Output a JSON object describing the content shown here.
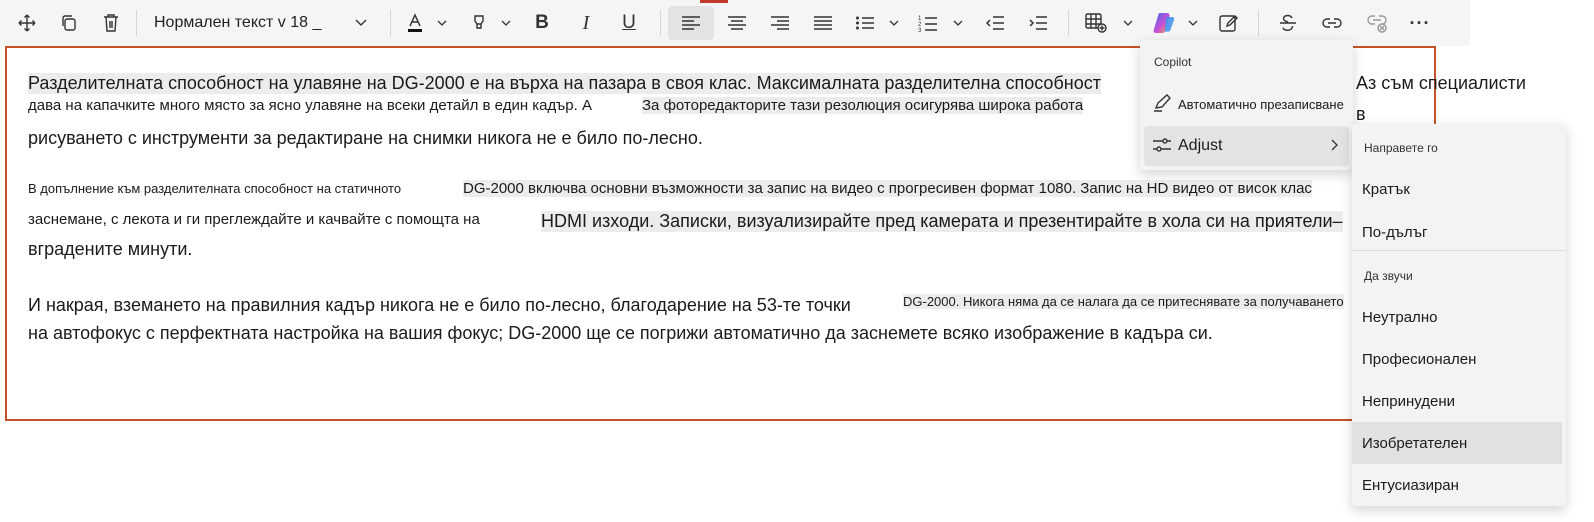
{
  "toolbar": {
    "style_value": "Нормален текст v 18 _",
    "buttons": [
      {
        "name": "move-icon"
      },
      {
        "name": "copy-icon"
      },
      {
        "name": "delete-icon"
      },
      {
        "name": "font-color-icon"
      },
      {
        "name": "highlight-icon"
      },
      {
        "name": "bold-icon"
      },
      {
        "name": "italic-icon"
      },
      {
        "name": "underline-icon"
      },
      {
        "name": "align-left-icon"
      },
      {
        "name": "align-center-icon"
      },
      {
        "name": "align-right-icon"
      },
      {
        "name": "justify-icon"
      },
      {
        "name": "bullet-list-icon"
      },
      {
        "name": "numbered-list-icon"
      },
      {
        "name": "decrease-indent-icon"
      },
      {
        "name": "increase-indent-icon"
      },
      {
        "name": "insert-table-icon"
      },
      {
        "name": "copilot-icon"
      },
      {
        "name": "rewrite-icon"
      },
      {
        "name": "strikethrough-icon"
      },
      {
        "name": "link-icon"
      },
      {
        "name": "unlink-icon"
      },
      {
        "name": "more-icon"
      }
    ],
    "bold_glyph": "B",
    "italic_glyph": "I",
    "underline_glyph": "U",
    "more_glyph": "···"
  },
  "document": {
    "lines": [
      {
        "text": "Разделителната способност на улавяне на DG-2000 е на върха на пазара в своя клас. Максималната разделителна способност",
        "size": "big",
        "hl": true
      },
      {
        "text": "дава на капачките много място за ясно улавяне на всеки детайл в един кадър. А",
        "size": "mid",
        "hl": false
      },
      {
        "text": "За фоторедакторите тази резолюция осигурява широка работа",
        "size": "mid",
        "hl": true
      },
      {
        "text": "рисуването с инструменти за редактиране на снимки никога не е било по-лесно.",
        "size": "big",
        "hl": false
      },
      {
        "text": "В допълнение към разделителната способност на статичното",
        "size": "small",
        "hl": false
      },
      {
        "text": "DG-2000 включва основни възможности за запис на видео с прогресивен формат 1080. Запис на HD видео от висок клас",
        "size": "mid",
        "hl": true
      },
      {
        "text": "заснемане, с лекота и ги преглеждайте и качвайте с помощта на",
        "size": "mid",
        "hl": false
      },
      {
        "text": "HDMI изходи. Записки, визуализирайте пред камерата и презентирайте в хола си на приятели–",
        "size": "big",
        "hl": true
      },
      {
        "text": "вградените минути.",
        "size": "big",
        "hl": false
      },
      {
        "text": "И накрая, вземането на правилния кадър никога не е било по-лесно, благодарение на 53-те точки",
        "size": "big",
        "hl": false
      },
      {
        "text": "DG-2000. Никога няма да се налага да се притеснявате за получаването",
        "size": "small",
        "hl": true
      },
      {
        "text": "на автофокус с перфектната настройка на вашия фокус; DG-2000 ще се погрижи автоматично да заснемете всяко изображение в кадъра си.",
        "size": "big",
        "hl": false
      }
    ],
    "side_text_1": "Аз съм специалисти",
    "side_text_2": "в"
  },
  "copilot_menu": {
    "header": "Copilot",
    "items": [
      {
        "label": "Автоматично презаписване",
        "icon": "rewrite-icon"
      },
      {
        "label": "Adjust",
        "icon": "adjust-icon"
      }
    ]
  },
  "adjust_menu": {
    "section1_header": "Направете го",
    "section1_items": [
      "Кратък",
      "По-дълъг"
    ],
    "section2_header": "Да звучи",
    "section2_items": [
      "Неутрално",
      "Професионален",
      "Непринудени",
      "Изобретателен",
      "Ентусиазиран"
    ],
    "selected": "Изобретателен"
  },
  "colors": {
    "frame_border": "#c5522a",
    "highlight": "#ececec",
    "copilot_gradient": [
      "#2f6fe4",
      "#c94fd8",
      "#f2a33a"
    ]
  }
}
